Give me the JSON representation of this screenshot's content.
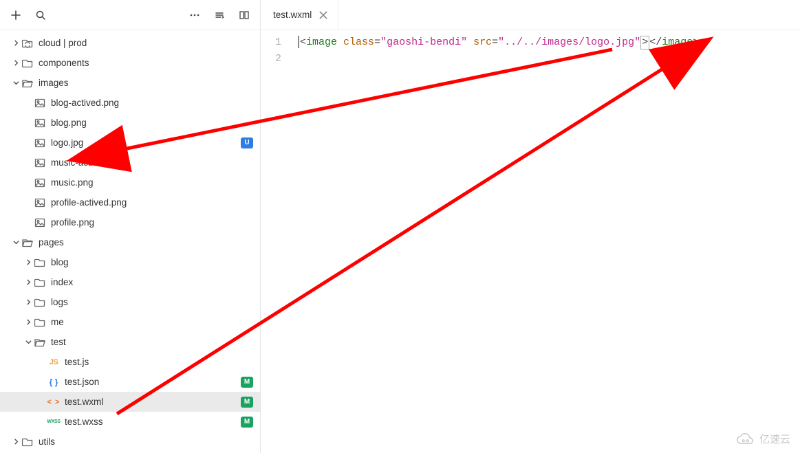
{
  "toolbar": {
    "search_placeholder": "",
    "new_file_aria": "New File",
    "search_aria": "Search",
    "more_aria": "More Actions",
    "collapse_aria": "Collapse",
    "split_aria": "Split Editor"
  },
  "tree": [
    {
      "type": "folder",
      "name": "cloud | prod",
      "level": 0,
      "caret": "right",
      "icon": "folder-sync"
    },
    {
      "type": "folder",
      "name": "components",
      "level": 0,
      "caret": "right",
      "icon": "folder"
    },
    {
      "type": "folder",
      "name": "images",
      "level": 0,
      "caret": "down",
      "icon": "folder-open"
    },
    {
      "type": "file",
      "name": "blog-actived.png",
      "level": 1,
      "icon": "image"
    },
    {
      "type": "file",
      "name": "blog.png",
      "level": 1,
      "icon": "image"
    },
    {
      "type": "file",
      "name": "logo.jpg",
      "level": 1,
      "icon": "image",
      "badge": "U"
    },
    {
      "type": "file",
      "name": "music-actived.png",
      "level": 1,
      "icon": "image"
    },
    {
      "type": "file",
      "name": "music.png",
      "level": 1,
      "icon": "image"
    },
    {
      "type": "file",
      "name": "profile-actived.png",
      "level": 1,
      "icon": "image"
    },
    {
      "type": "file",
      "name": "profile.png",
      "level": 1,
      "icon": "image"
    },
    {
      "type": "folder",
      "name": "pages",
      "level": 0,
      "caret": "down",
      "icon": "folder-open"
    },
    {
      "type": "folder",
      "name": "blog",
      "level": 1,
      "caret": "right",
      "icon": "folder"
    },
    {
      "type": "folder",
      "name": "index",
      "level": 1,
      "caret": "right",
      "icon": "folder"
    },
    {
      "type": "folder",
      "name": "logs",
      "level": 1,
      "caret": "right",
      "icon": "folder"
    },
    {
      "type": "folder",
      "name": "me",
      "level": 1,
      "caret": "right",
      "icon": "folder"
    },
    {
      "type": "folder",
      "name": "test",
      "level": 1,
      "caret": "down",
      "icon": "folder-open"
    },
    {
      "type": "file",
      "name": "test.js",
      "level": 2,
      "icon": "js"
    },
    {
      "type": "file",
      "name": "test.json",
      "level": 2,
      "icon": "json",
      "badge": "M"
    },
    {
      "type": "file",
      "name": "test.wxml",
      "level": 2,
      "icon": "wxml",
      "badge": "M",
      "active": true
    },
    {
      "type": "file",
      "name": "test.wxss",
      "level": 2,
      "icon": "wxss",
      "badge": "M"
    },
    {
      "type": "folder",
      "name": "utils",
      "level": 0,
      "caret": "right",
      "icon": "folder"
    }
  ],
  "editor": {
    "open_tab": "test.wxml",
    "lines": [
      {
        "num": 1,
        "tokens": [
          {
            "t": "punct",
            "v": "<"
          },
          {
            "t": "tag",
            "v": "image"
          },
          {
            "t": "plain",
            "v": " "
          },
          {
            "t": "attr",
            "v": "class"
          },
          {
            "t": "punct",
            "v": "="
          },
          {
            "t": "str",
            "v": "\"gaoshi-bendi\""
          },
          {
            "t": "plain",
            "v": " "
          },
          {
            "t": "attr",
            "v": "src"
          },
          {
            "t": "punct",
            "v": "="
          },
          {
            "t": "str",
            "v": "\"../../images/logo.jpg\""
          },
          {
            "t": "punct",
            "v": ">"
          },
          {
            "t": "punct",
            "v": "</"
          },
          {
            "t": "tag",
            "v": "image"
          },
          {
            "t": "punct",
            "v": ">"
          }
        ]
      },
      {
        "num": 2,
        "tokens": []
      }
    ]
  },
  "watermark": {
    "text": "亿速云"
  },
  "icons": {
    "js_label": "JS",
    "json_label": "{ }",
    "wxml_label": "< >",
    "wxss_label": "WXSS"
  }
}
